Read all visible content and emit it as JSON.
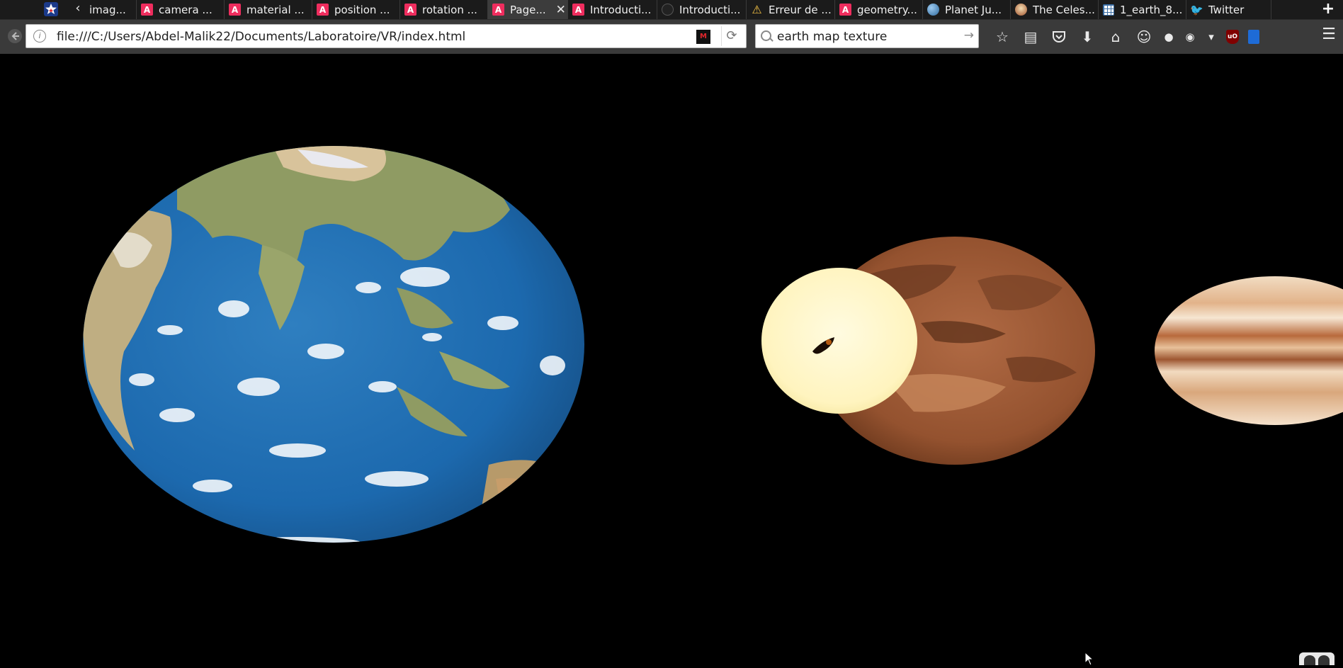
{
  "tabs": [
    {
      "label": "imag...",
      "favicon": "aframe-icon",
      "active": false
    },
    {
      "label": "camera ...",
      "favicon": "aframe-icon",
      "active": false
    },
    {
      "label": "material ...",
      "favicon": "aframe-icon",
      "active": false
    },
    {
      "label": "position ...",
      "favicon": "aframe-icon",
      "active": false
    },
    {
      "label": "rotation ...",
      "favicon": "aframe-icon",
      "active": false
    },
    {
      "label": "Page...",
      "favicon": "aframe-icon",
      "active": true
    },
    {
      "label": "Introducti...",
      "favicon": "aframe-icon",
      "active": false
    },
    {
      "label": "Introducti...",
      "favicon": "github-icon",
      "active": false
    },
    {
      "label": "Erreur de ...",
      "favicon": "warning-icon",
      "active": false
    },
    {
      "label": "geometry...",
      "favicon": "aframe-icon",
      "active": false
    },
    {
      "label": "Planet Ju...",
      "favicon": "globe-icon",
      "active": false
    },
    {
      "label": "The Celes...",
      "favicon": "face-icon",
      "active": false
    },
    {
      "label": "1_earth_8...",
      "favicon": "sheet-icon",
      "active": false
    },
    {
      "label": "Twitter",
      "favicon": "twitter-bird-icon",
      "active": false
    }
  ],
  "tab_favicon_letter": "A",
  "nav": {
    "url": "file:///C:/Users/Abdel-Malik22/Documents/Laboratoire/VR/index.html",
    "search_query": "earth map texture"
  },
  "colors": {
    "scene_background": "#000000",
    "tab_strip": "#1b1b1b",
    "nav_bar": "#3a3a3a",
    "aframe_red": "#ef2d5e"
  },
  "scene": {
    "objects": [
      "earth-sphere",
      "sun-sphere",
      "mars-sphere",
      "jupiter-sphere"
    ]
  }
}
